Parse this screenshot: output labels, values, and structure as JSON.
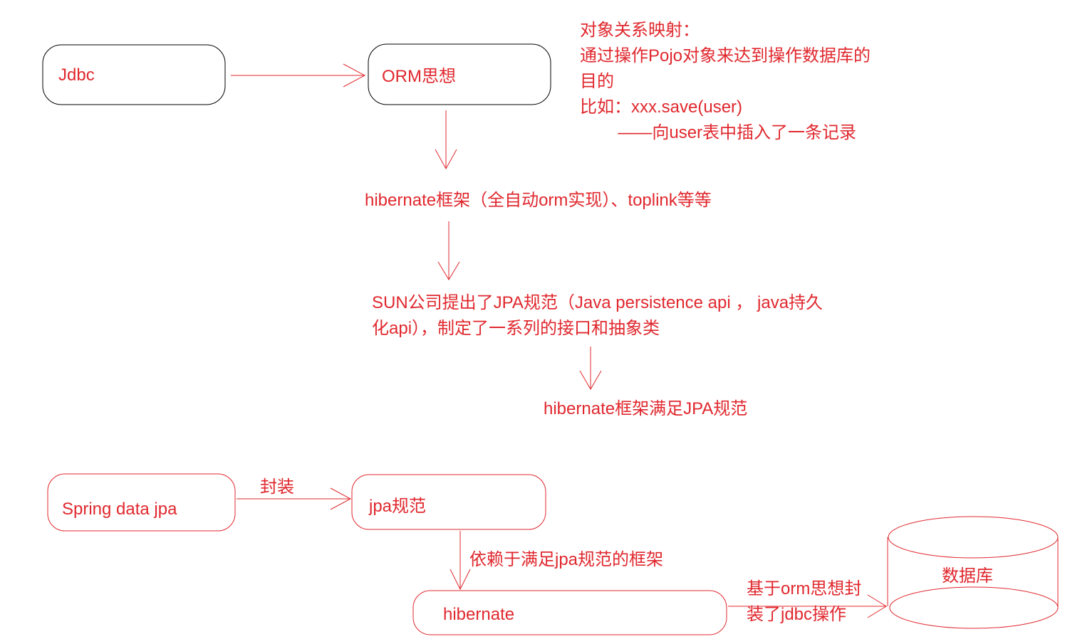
{
  "colors": {
    "text": "#e0282e",
    "line": "#e0282e",
    "box_black_border": "#000000",
    "background": "#ffffff"
  },
  "nodes": {
    "jdbc": {
      "label": "Jdbc"
    },
    "orm": {
      "label": "ORM思想"
    },
    "orm_note": {
      "lines": [
        "对象关系映射：",
        "通过操作Pojo对象来达到操作数据库的",
        "目的",
        "比如：xxx.save(user)",
        "        ——向user表中插入了一条记录"
      ]
    },
    "hibernate_frameworks": {
      "label": "hibernate框架（全自动orm实现）、toplink等等"
    },
    "sun_jpa": {
      "lines": [
        "SUN公司提出了JPA规范（Java persistence api ， java持久",
        "化api），制定了一系列的接口和抽象类"
      ]
    },
    "hibernate_satisfies": {
      "label": "hibernate框架满足JPA规范"
    },
    "spring_data_jpa": {
      "label": "Spring data jpa"
    },
    "jpa_spec": {
      "label": "jpa规范"
    },
    "hibernate": {
      "label": "hibernate"
    },
    "database": {
      "label": "数据库"
    }
  },
  "edges": {
    "wrap": {
      "label": "封装"
    },
    "depends": {
      "label": "依赖于满足jpa规范的框架"
    },
    "orm_wraps_jdbc": {
      "lines": [
        "基于orm思想封",
        "装了jdbc操作"
      ]
    }
  }
}
